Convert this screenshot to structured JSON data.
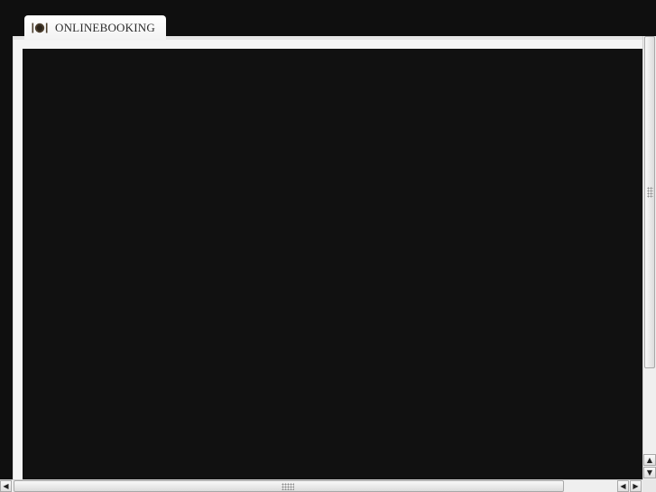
{
  "tab": {
    "label": "ONLINEBOOKING",
    "icon": "plate-cutlery-icon"
  },
  "scrollbars": {
    "up_arrow": "▲",
    "down_arrow": "▼",
    "left_arrow": "◀",
    "right_arrow": "▶"
  },
  "colors": {
    "content_background": "#111111",
    "frame": "#f4f4f4",
    "page_background": "#0f0f0f"
  }
}
